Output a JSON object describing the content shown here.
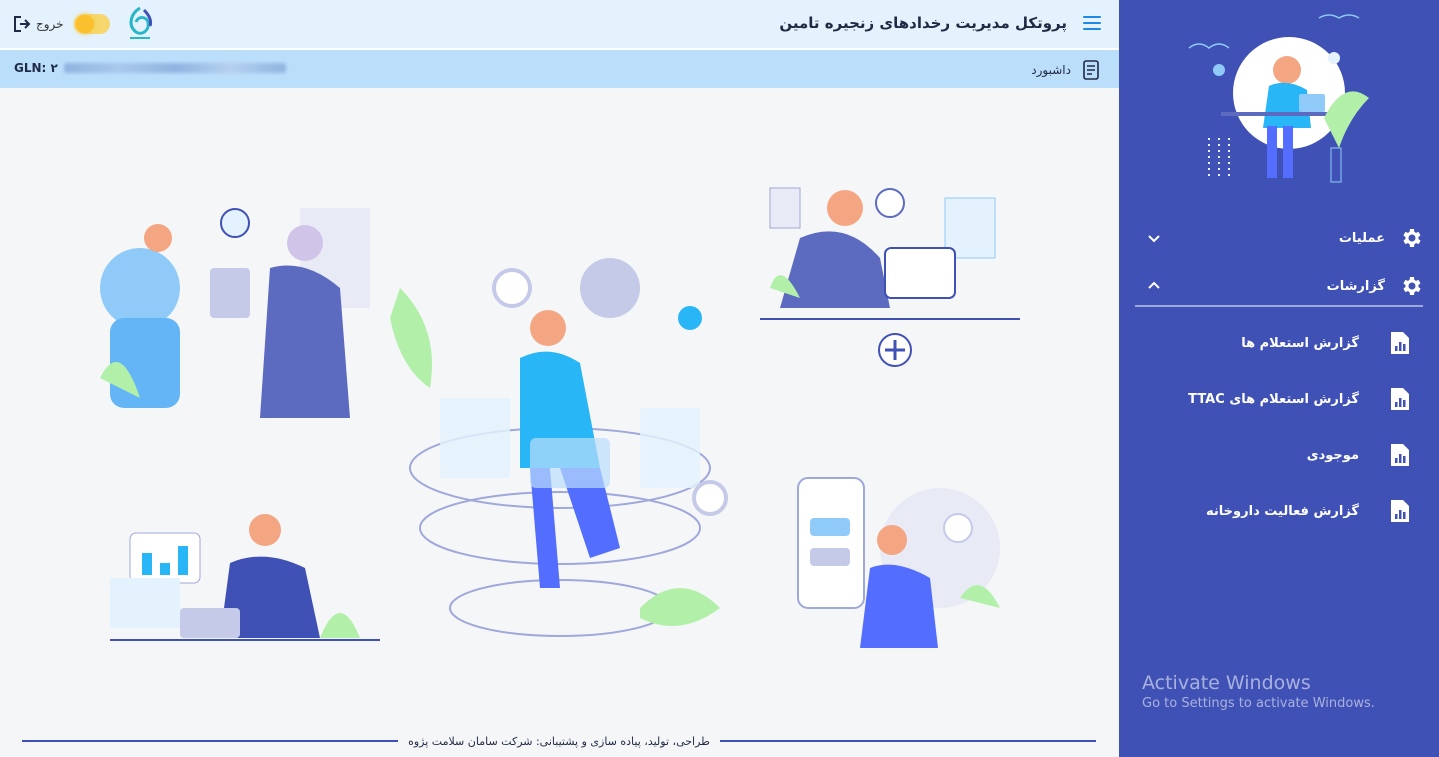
{
  "header": {
    "title": "پروتکل مدیریت رخدادهای زنجیره تامین",
    "logout_label": "خروج",
    "menu_icon": "hamburger-icon",
    "theme_toggle_icon": "sun-icon"
  },
  "subheader": {
    "gln_label": "GLN: ۲",
    "breadcrumb": "داشبورد",
    "breadcrumb_icon": "document-list-icon"
  },
  "sidebar": {
    "menus": [
      {
        "label": "عملیات",
        "icon": "gear-icon",
        "expanded": false
      },
      {
        "label": "گزارشات",
        "icon": "gear-icon",
        "expanded": true
      }
    ],
    "reports": [
      {
        "label": "گزارش استعلام ها",
        "icon": "report-document-icon"
      },
      {
        "label": "گزارش استعلام های TTAC",
        "icon": "report-document-icon"
      },
      {
        "label": "موجودی",
        "icon": "report-document-icon"
      },
      {
        "label": "گزارش فعالیت داروخانه",
        "icon": "report-document-icon"
      }
    ]
  },
  "footer": {
    "credits": "طراحی، تولید، پیاده سازی و پشتیبانی: شرکت سامان سلامت پژوه"
  },
  "watermark": {
    "title": "Activate Windows",
    "subtitle": "Go to Settings to activate Windows."
  },
  "colors": {
    "sidebar_bg": "#3f51b5",
    "header_bg": "#e3f2fd",
    "subheader_bg": "#bbdefb",
    "main_bg": "#f5f6f8",
    "accent": "#1e88e5"
  }
}
